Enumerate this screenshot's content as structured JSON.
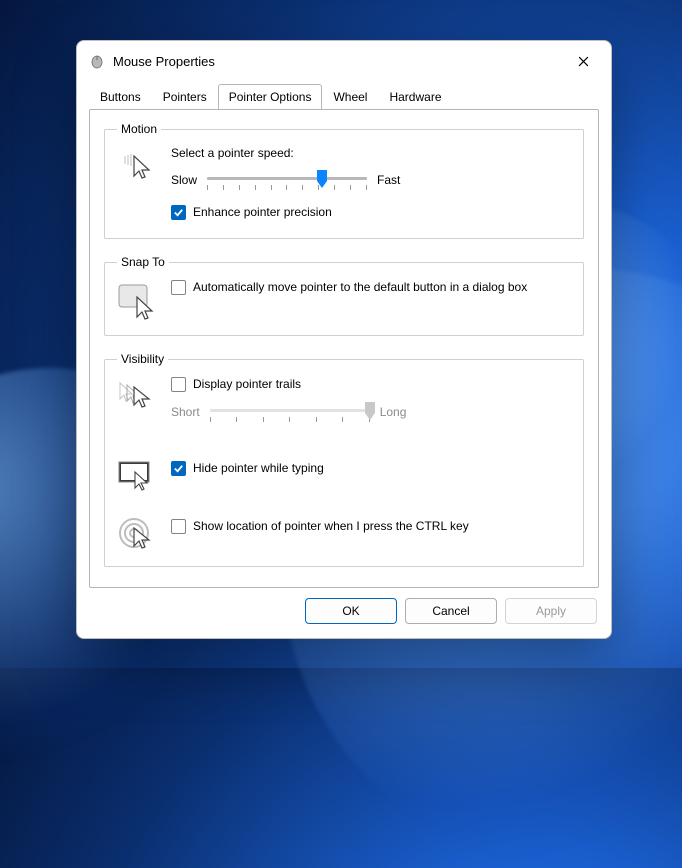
{
  "window": {
    "title": "Mouse Properties"
  },
  "tabs": {
    "buttons": "Buttons",
    "pointers": "Pointers",
    "pointer_options": "Pointer Options",
    "wheel": "Wheel",
    "hardware": "Hardware",
    "active": "pointer_options"
  },
  "motion": {
    "legend": "Motion",
    "select_speed": "Select a pointer speed:",
    "slow": "Slow",
    "fast": "Fast",
    "enhance": "Enhance pointer precision",
    "enhance_checked": true,
    "speed_value": 7,
    "speed_max": 11
  },
  "snap": {
    "legend": "Snap To",
    "auto_move": "Automatically move pointer to the default button in a dialog box",
    "auto_move_checked": false
  },
  "visibility": {
    "legend": "Visibility",
    "trails": "Display pointer trails",
    "trails_checked": false,
    "short": "Short",
    "long": "Long",
    "hide_typing": "Hide pointer while typing",
    "hide_typing_checked": true,
    "ctrl_locate": "Show location of pointer when I press the CTRL key",
    "ctrl_locate_checked": false
  },
  "buttons": {
    "ok": "OK",
    "cancel": "Cancel",
    "apply": "Apply"
  }
}
